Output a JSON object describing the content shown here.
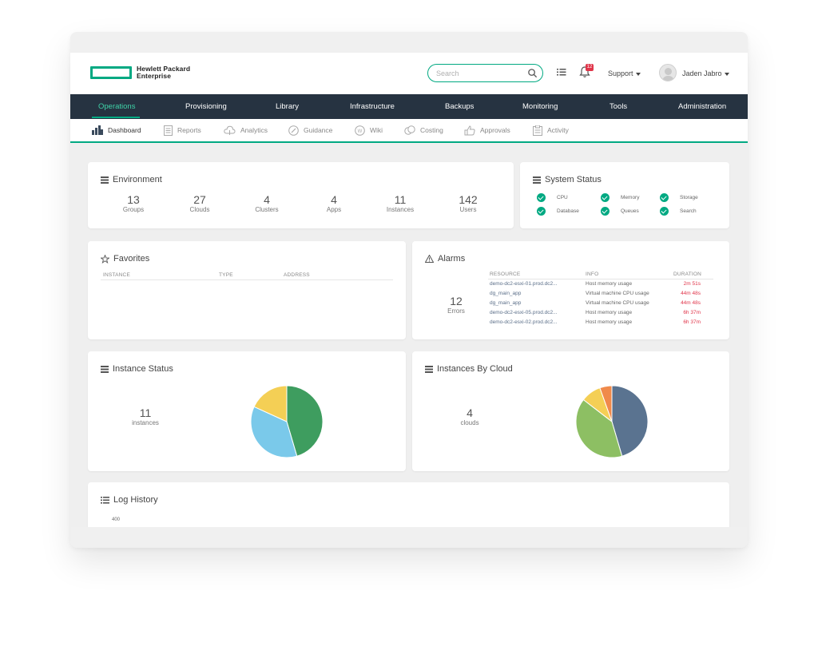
{
  "brand": {
    "line1": "Hewlett Packard",
    "line2": "Enterprise",
    "logo_color": "#01a982"
  },
  "header": {
    "search_placeholder": "Search",
    "notification_count": "12",
    "support_label": "Support",
    "user_name": "Jaden Jabro"
  },
  "topnav": {
    "items": [
      "Operations",
      "Provisioning",
      "Library",
      "Infrastructure",
      "Backups",
      "Monitoring",
      "Tools",
      "Administration"
    ],
    "active": "Operations"
  },
  "subnav": {
    "items": [
      "Dashboard",
      "Reports",
      "Analytics",
      "Guidance",
      "Wiki",
      "Costing",
      "Approvals",
      "Activity"
    ],
    "active": "Dashboard"
  },
  "environment": {
    "title": "Environment",
    "stats": [
      {
        "value": "13",
        "label": "Groups"
      },
      {
        "value": "27",
        "label": "Clouds"
      },
      {
        "value": "4",
        "label": "Clusters"
      },
      {
        "value": "4",
        "label": "Apps"
      },
      {
        "value": "11",
        "label": "Instances"
      },
      {
        "value": "142",
        "label": "Users"
      }
    ]
  },
  "system_status": {
    "title": "System Status",
    "items": [
      "CPU",
      "Memory",
      "Storage",
      "Database",
      "Queues",
      "Search"
    ]
  },
  "favorites": {
    "title": "Favorites",
    "columns": [
      "INSTANCE",
      "TYPE",
      "ADDRESS"
    ]
  },
  "alarms": {
    "title": "Alarms",
    "errors_count": "12",
    "errors_label": "Errors",
    "columns": [
      "RESOURCE",
      "INFO",
      "DURATION"
    ],
    "rows": [
      {
        "resource": "demo-dc2-esxi-01.prod.dc2...",
        "info": "Host memory usage",
        "duration": "2m 51s"
      },
      {
        "resource": "dg_main_app",
        "info": "Virtual machine CPU usage",
        "duration": "44m 48s"
      },
      {
        "resource": "dg_main_app",
        "info": "Virtual machine CPU usage",
        "duration": "44m 48s"
      },
      {
        "resource": "demo-dc2-esxi-05.prod.dc2...",
        "info": "Host memory usage",
        "duration": "6h 37m"
      },
      {
        "resource": "demo-dc2-esxi-02.prod.dc2...",
        "info": "Host memory usage",
        "duration": "6h 37m"
      }
    ]
  },
  "instance_status": {
    "title": "Instance Status",
    "count": "11",
    "count_label": "instances",
    "slices": [
      {
        "value": 5,
        "color": "#3e9d5f"
      },
      {
        "value": 4,
        "color": "#7ac9ea"
      },
      {
        "value": 2,
        "color": "#f4cf55"
      }
    ]
  },
  "instances_by_cloud": {
    "title": "Instances By Cloud",
    "count": "4",
    "count_label": "clouds",
    "slices": [
      {
        "value": 5,
        "color": "#5a7390"
      },
      {
        "value": 4.4,
        "color": "#8dbf63"
      },
      {
        "value": 1,
        "color": "#f4cf55"
      },
      {
        "value": 0.6,
        "color": "#f08a4b"
      }
    ]
  },
  "log_history": {
    "title": "Log History",
    "y_top_label": "400"
  }
}
